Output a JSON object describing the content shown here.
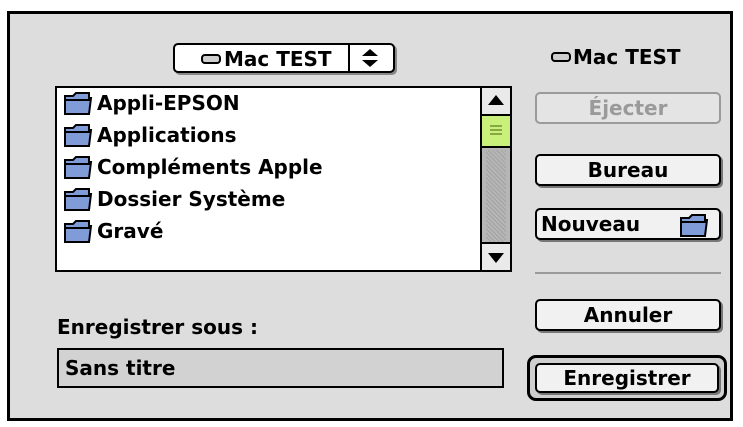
{
  "dialog": {
    "location_popup": {
      "label": "Mac TEST",
      "icon": "hard-disk-icon"
    },
    "volume": {
      "label": "Mac TEST",
      "icon": "hard-disk-icon"
    },
    "file_list": {
      "items": [
        {
          "label": "Appli-EPSON",
          "icon": "folder-icon"
        },
        {
          "label": "Applications",
          "icon": "folder-icon"
        },
        {
          "label": "Compléments Apple",
          "icon": "folder-icon"
        },
        {
          "label": "Dossier Système",
          "icon": "folder-icon"
        },
        {
          "label": "Gravé",
          "icon": "folder-icon"
        }
      ],
      "scroll_position": 0.0
    },
    "buttons": {
      "eject": "Éjecter",
      "desktop": "Bureau",
      "new": "Nouveau",
      "cancel": "Annuler",
      "save": "Enregistrer"
    },
    "save_as_label": "Enregistrer sous :",
    "name_field": {
      "value": "Sans titre"
    }
  },
  "colors": {
    "dialog_background": "#dddddd",
    "scroll_thumb": "#c8f07a",
    "folder_blue": "#7f9bd8"
  }
}
